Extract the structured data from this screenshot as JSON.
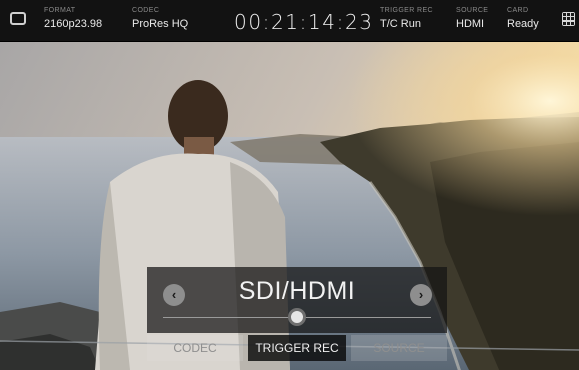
{
  "status_bar": {
    "format": {
      "label": "FORMAT",
      "value": "2160p23.98"
    },
    "codec": {
      "label": "CODEC",
      "value": "ProRes HQ"
    },
    "timecode": "00:21:14:23",
    "trigger_rec": {
      "label": "TRIGGER REC",
      "value": "T/C Run"
    },
    "source": {
      "label": "SOURCE",
      "value": "HDMI"
    },
    "card": {
      "label": "CARD",
      "value": "Ready"
    }
  },
  "menu": {
    "title": "SDI/HDMI",
    "slider_position_fraction": 0.5,
    "tabs": [
      {
        "label": "CODEC",
        "active": false
      },
      {
        "label": "TRIGGER REC",
        "active": true
      },
      {
        "label": "SOURCE",
        "active": false
      }
    ]
  },
  "icons": {
    "left_icon": "monitor-icon",
    "right_icon": "grid-menu-icon",
    "prev": "chevron-left-icon",
    "next": "chevron-right-icon"
  },
  "colors": {
    "bar_bg": "#121212",
    "overlay_bg": "#141414",
    "active_tab_text": "#f0f0f0",
    "inactive_tab_text": "#8f8f8f"
  }
}
